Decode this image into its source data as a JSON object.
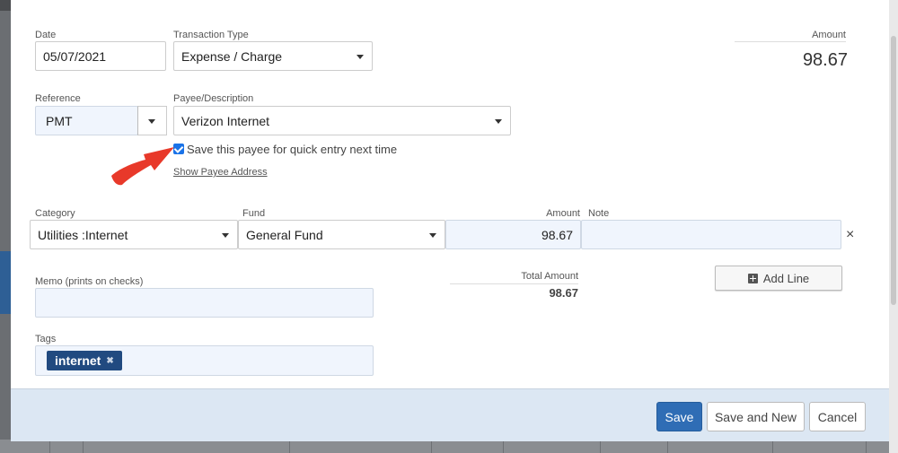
{
  "form": {
    "date": {
      "label": "Date",
      "value": "05/07/2021"
    },
    "transaction_type": {
      "label": "Transaction Type",
      "value": "Expense / Charge"
    },
    "amount": {
      "label": "Amount",
      "value": "98.67"
    },
    "reference": {
      "label": "Reference",
      "value": "PMT"
    },
    "payee": {
      "label": "Payee/Description",
      "value": "Verizon Internet"
    },
    "save_payee": {
      "label": "Save this payee for quick entry next time",
      "checked": true
    },
    "show_payee_address": "Show Payee Address"
  },
  "lines": {
    "headers": {
      "category": "Category",
      "fund": "Fund",
      "amount": "Amount",
      "note": "Note"
    },
    "rows": [
      {
        "category": "Utilities :Internet",
        "fund": "General Fund",
        "amount": "98.67",
        "note": ""
      }
    ],
    "remove_icon": "×"
  },
  "add_line": {
    "label": "Add Line",
    "icon": "plus-square-icon"
  },
  "total": {
    "label": "Total Amount",
    "value": "98.67"
  },
  "memo": {
    "label": "Memo (prints on checks)",
    "value": ""
  },
  "tags": {
    "label": "Tags",
    "items": [
      {
        "name": "internet",
        "remove": "✖"
      }
    ]
  },
  "footer": {
    "save": "Save",
    "save_and_new": "Save and New",
    "cancel": "Cancel"
  },
  "colors": {
    "accent": "#2f6db5",
    "tag": "#214a80",
    "footer_bg": "#dce7f3",
    "arrow": "#e8392a"
  }
}
